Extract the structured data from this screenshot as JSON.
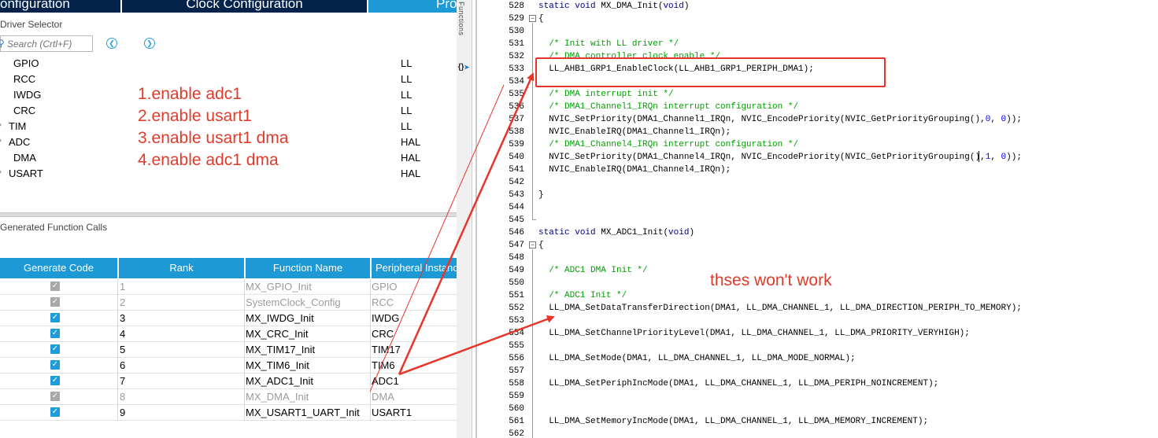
{
  "tabs": {
    "config": "onfiguration",
    "clock": "Clock Configuration",
    "project": "Pro"
  },
  "driver_selector": {
    "title": "Driver Selector",
    "search_placeholder": "Search (Crtl+F)",
    "prev_icon": "chevron-left-circle-icon",
    "next_icon": "chevron-right-circle-icon",
    "rows": [
      {
        "name": "GPIO",
        "lib": "LL",
        "expandable": false
      },
      {
        "name": "RCC",
        "lib": "LL",
        "expandable": false
      },
      {
        "name": "IWDG",
        "lib": "LL",
        "expandable": false
      },
      {
        "name": "CRC",
        "lib": "LL",
        "expandable": false
      },
      {
        "name": "TIM",
        "lib": "LL",
        "expandable": true
      },
      {
        "name": "ADC",
        "lib": "HAL",
        "expandable": true
      },
      {
        "name": "DMA",
        "lib": "HAL",
        "expandable": false
      },
      {
        "name": "USART",
        "lib": "HAL",
        "expandable": true
      }
    ]
  },
  "notes": [
    "1.enable adc1",
    "2.enable usart1",
    "3.enable usart1 dma",
    "4.enable adc1 dma"
  ],
  "generated_calls": {
    "title": "Generated Function Calls",
    "columns": [
      "Generate Code",
      "Rank",
      "Function Name",
      "Peripheral Instanc"
    ],
    "rows": [
      {
        "checked": true,
        "disabled": true,
        "rank": "1",
        "fn": "MX_GPIO_Init",
        "per": "GPIO"
      },
      {
        "checked": true,
        "disabled": true,
        "rank": "2",
        "fn": "SystemClock_Config",
        "per": "RCC"
      },
      {
        "checked": true,
        "disabled": false,
        "rank": "3",
        "fn": "MX_IWDG_Init",
        "per": "IWDG"
      },
      {
        "checked": true,
        "disabled": false,
        "rank": "4",
        "fn": "MX_CRC_Init",
        "per": "CRC"
      },
      {
        "checked": true,
        "disabled": false,
        "rank": "5",
        "fn": "MX_TIM17_Init",
        "per": "TIM17"
      },
      {
        "checked": true,
        "disabled": false,
        "rank": "6",
        "fn": "MX_TIM6_Init",
        "per": "TIM6"
      },
      {
        "checked": true,
        "disabled": false,
        "rank": "7",
        "fn": "MX_ADC1_Init",
        "per": "ADC1"
      },
      {
        "checked": true,
        "disabled": true,
        "rank": "8",
        "fn": "MX_DMA_Init",
        "per": "DMA"
      },
      {
        "checked": true,
        "disabled": false,
        "rank": "9",
        "fn": "MX_USART1_UART_Init",
        "per": "USART1"
      }
    ]
  },
  "editor": {
    "functions_label": "Functions",
    "functions_button": "{}",
    "lines": [
      {
        "n": "528",
        "code": "static void MX_DMA_Init(void)"
      },
      {
        "n": "529",
        "code": "{"
      },
      {
        "n": "530",
        "code": ""
      },
      {
        "n": "531",
        "code": "  /* Init with LL driver */"
      },
      {
        "n": "532",
        "code": "  /* DMA controller clock enable */"
      },
      {
        "n": "533",
        "code": "  LL_AHB1_GRP1_EnableClock(LL_AHB1_GRP1_PERIPH_DMA1);"
      },
      {
        "n": "534",
        "code": ""
      },
      {
        "n": "535",
        "code": "  /* DMA interrupt init */"
      },
      {
        "n": "536",
        "code": "  /* DMA1_Channel1_IRQn interrupt configuration */"
      },
      {
        "n": "537",
        "code": "  NVIC_SetPriority(DMA1_Channel1_IRQn, NVIC_EncodePriority(NVIC_GetPriorityGrouping(),0, 0));"
      },
      {
        "n": "538",
        "code": "  NVIC_EnableIRQ(DMA1_Channel1_IRQn);"
      },
      {
        "n": "539",
        "code": "  /* DMA1_Channel4_IRQn interrupt configuration */"
      },
      {
        "n": "540",
        "code": "  NVIC_SetPriority(DMA1_Channel4_IRQn, NVIC_EncodePriority(NVIC_GetPriorityGrouping(),1, 0));"
      },
      {
        "n": "541",
        "code": "  NVIC_EnableIRQ(DMA1_Channel4_IRQn);"
      },
      {
        "n": "542",
        "code": ""
      },
      {
        "n": "543",
        "code": "}"
      },
      {
        "n": "544",
        "code": ""
      },
      {
        "n": "545",
        "code": ""
      },
      {
        "n": "546",
        "code": "static void MX_ADC1_Init(void)"
      },
      {
        "n": "547",
        "code": "{"
      },
      {
        "n": "548",
        "code": ""
      },
      {
        "n": "549",
        "code": "  /* ADC1 DMA Init */"
      },
      {
        "n": "550",
        "code": ""
      },
      {
        "n": "551",
        "code": "  /* ADC1 Init */"
      },
      {
        "n": "552",
        "code": "  LL_DMA_SetDataTransferDirection(DMA1, LL_DMA_CHANNEL_1, LL_DMA_DIRECTION_PERIPH_TO_MEMORY);"
      },
      {
        "n": "553",
        "code": ""
      },
      {
        "n": "554",
        "code": "  LL_DMA_SetChannelPriorityLevel(DMA1, LL_DMA_CHANNEL_1, LL_DMA_PRIORITY_VERYHIGH);"
      },
      {
        "n": "555",
        "code": ""
      },
      {
        "n": "556",
        "code": "  LL_DMA_SetMode(DMA1, LL_DMA_CHANNEL_1, LL_DMA_MODE_NORMAL);"
      },
      {
        "n": "557",
        "code": ""
      },
      {
        "n": "558",
        "code": "  LL_DMA_SetPeriphIncMode(DMA1, LL_DMA_CHANNEL_1, LL_DMA_PERIPH_NOINCREMENT);"
      },
      {
        "n": "559",
        "code": ""
      },
      {
        "n": "560",
        "code": ""
      },
      {
        "n": "561",
        "code": "  LL_DMA_SetMemoryIncMode(DMA1, LL_DMA_CHANNEL_1, LL_DMA_MEMORY_INCREMENT);"
      },
      {
        "n": "562",
        "code": ""
      }
    ]
  },
  "annotation": {
    "wont_work": "thses won't work",
    "color": "#e03b2a"
  },
  "colors": {
    "tab_dark": "#03234b",
    "accent": "#1d9ad6",
    "comment": "#00a000",
    "keyword": "#00007f",
    "number": "#0000ff"
  }
}
